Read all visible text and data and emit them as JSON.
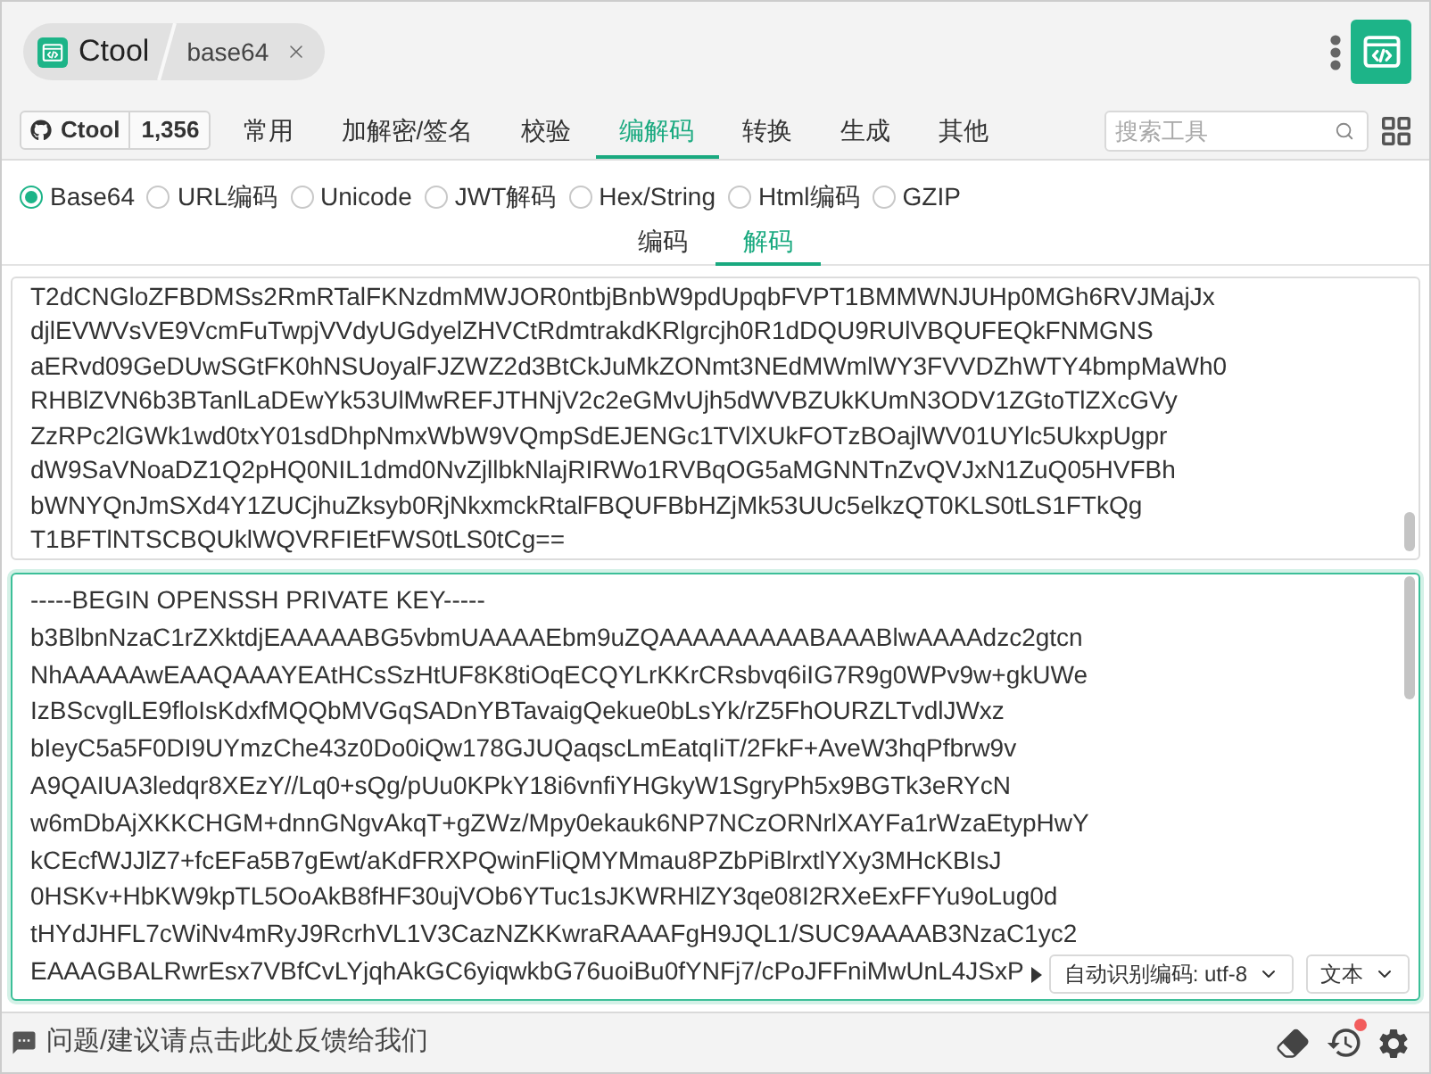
{
  "tab_bar": {
    "home": "Ctool",
    "open_tab": "base64"
  },
  "github_badge": {
    "label": "Ctool",
    "count": "1,356"
  },
  "categories": [
    {
      "label": "常用",
      "selected": false
    },
    {
      "label": "加解密/签名",
      "selected": false
    },
    {
      "label": "校验",
      "selected": false
    },
    {
      "label": "编解码",
      "selected": true
    },
    {
      "label": "转换",
      "selected": false
    },
    {
      "label": "生成",
      "selected": false
    },
    {
      "label": "其他",
      "selected": false
    }
  ],
  "search": {
    "placeholder": "搜索工具"
  },
  "encodings": [
    {
      "label": "Base64",
      "selected": true
    },
    {
      "label": "URL编码",
      "selected": false
    },
    {
      "label": "Unicode",
      "selected": false
    },
    {
      "label": "JWT解码",
      "selected": false
    },
    {
      "label": "Hex/String",
      "selected": false
    },
    {
      "label": "Html编码",
      "selected": false
    },
    {
      "label": "GZIP",
      "selected": false
    }
  ],
  "modes": [
    {
      "label": "编码",
      "selected": false
    },
    {
      "label": "解码",
      "selected": true
    }
  ],
  "input": {
    "focused": false,
    "lines": [
      "T2dCNGloZFBDMSs2RmRTalFKNzdmMWJOR0ntbjBnbW9pdUpqbFVPT1BMMWNJUHp0MGh6RVJMajJx",
      "djlEVWVsVE9VcmFuTwpjVVdyUGdyelZHVCtRdmtrakdKRlgrcjh0R1dDQU9RUlVBQUFEQkFNMGNS",
      "aERvd09GeDUwSGtFK0hNSUoyalFJZWZ2d3BtCkJuMkZONmt3NEdMWmlWY3FVVDZhWTY4bmpMaWh0",
      "RHBlZVN6b3BTanlLaDEwYk53UlMwREFJTHNjV2c2eGMvUjh5dWVBZUkKUmN3ODV1ZGtoTlZXcGVy",
      "ZzRPc2lGWk1wd0txY01sdDhpNmxWbW9VQmpSdEJENGc1TVlXUkFOTzBOajlWV01UYlc5UkxpUgpr",
      "dW9SaVNoaDZ1Q2pHQ0NIL1dmd0NvZjllbkNlajRIRWo1RVBqOG5aMGNNTnZvQVJxN1ZuQ05HVFBh",
      "bWNYQnJmSXd4Y1ZUCjhuZksyb0RjNkxmckRtalFBQUFBbHZjMk53UUc5elkzQT0KLS0tLS1FTkQg",
      "T1BFTlNTSCBQUklWQVRFIEtFWS0tLS0tCg=="
    ]
  },
  "output": {
    "focused": true,
    "lines": [
      "-----BEGIN OPENSSH PRIVATE KEY-----",
      "b3BlbnNzaC1rZXktdjEAAAAABG5vbmUAAAAEbm9uZQAAAAAAAAABAAABlwAAAAdzc2gtcn",
      "NhAAAAAwEAAQAAAYEAtHCsSzHtUF8K8tiOqECQYLrKKrCRsbvq6iIG7R9g0WPv9w+gkUWe",
      "IzBScvglLE9floIsKdxfMQQbMVGqSADnYBTavaigQekue0bLsYk/rZ5FhOURZLTvdlJWxz",
      "bIeyC5a5F0DI9UYmzChe43z0Do0iQw178GJUQaqscLmEatqIiT/2FkF+AveW3hqPfbrw9v",
      "A9QAIUA3ledqr8XEzY//Lq0+sQg/pUu0KPkY18i6vnfiYHGkyW1SgryPh5x9BGTk3eRYcN",
      "w6mDbAjXKKCHGM+dnnGNgvAkqT+gZWz/Mpy0ekauk6NP7NCzORNrlXAYFa1rWzaEtypHwY",
      "kCEcfWJJlZ7+fcEFa5B7gEwt/aKdFRXPQwinFliQMYMmau8PZbPiBlrxtlYXy3MHcKBIsJ",
      "0HSKv+HbKW9kpTL5OoAkB8fHF30ujVOb6YTuc1sJKWRHlZY3qe08I2RXeExFFYu9oLug0d",
      "tHYdJHFL7cWiNv4mRyJ9RcrhVL1V3CazNZKKwraRAAAFgH9JQL1/SUC9AAAAB3NzaC1yc2",
      "EAAAGBALRwrEsx7VBfCvLYjqhAkGC6yiqwkbG76uoiBu0fYNFj7/cPoJFFniMwUnL4JSxP"
    ]
  },
  "encoding_select": {
    "value": "自动识别编码: utf-8"
  },
  "format_select": {
    "value": "文本"
  },
  "footer": {
    "feedback": "问题/建议请点击此处反馈给我们",
    "history_unread": true
  }
}
